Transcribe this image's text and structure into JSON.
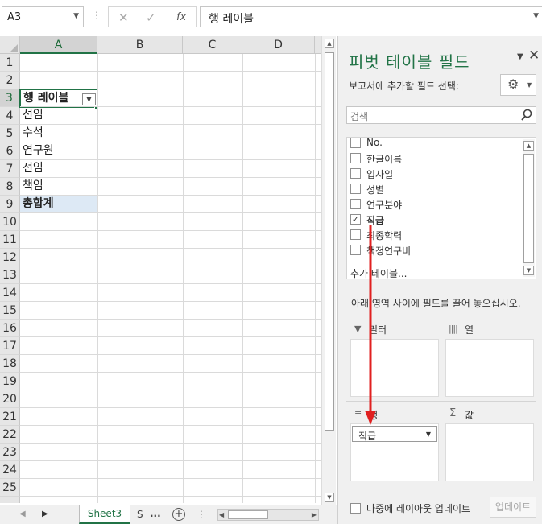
{
  "formula_bar": {
    "name_box": "A3",
    "cancel_icon": "✕",
    "enter_icon": "✓",
    "function_icon": "fx",
    "content": "행 레이블"
  },
  "grid": {
    "columns": [
      "A",
      "B",
      "C",
      "D"
    ],
    "rows": [
      "1",
      "2",
      "3",
      "4",
      "5",
      "6",
      "7",
      "8",
      "9",
      "10",
      "11",
      "12",
      "13",
      "14",
      "15",
      "16",
      "17",
      "18",
      "19",
      "20",
      "21",
      "22",
      "23",
      "24",
      "25"
    ],
    "cells": {
      "A3": "행 레이블",
      "A4": "선임",
      "A5": "수석",
      "A6": "연구원",
      "A7": "전임",
      "A8": "책임",
      "A9": "총합계"
    },
    "active_cell": "A3"
  },
  "sheet_tabs": {
    "active_tab": "Sheet3",
    "truncated_tab": "S",
    "more": "...",
    "add": "+"
  },
  "pivot_pane": {
    "title": "피벗 테이블 필드",
    "subtitle": "보고서에 추가할 필드 선택:",
    "search_placeholder": "검색",
    "fields": [
      {
        "label": "No.",
        "checked": false
      },
      {
        "label": "한글이름",
        "checked": false
      },
      {
        "label": "입사일",
        "checked": false
      },
      {
        "label": "성별",
        "checked": false
      },
      {
        "label": "연구분야",
        "checked": false
      },
      {
        "label": "직급",
        "checked": true
      },
      {
        "label": "최종학력",
        "checked": false
      },
      {
        "label": "책정연구비",
        "checked": false
      }
    ],
    "more_tables": "추가 테이블...",
    "areas_instructions": "아래 영역 사이에 필드를 끌어 놓으십시오.",
    "areas": {
      "filters": "필터",
      "columns": "열",
      "rows": "행",
      "values": "값"
    },
    "rows_chip": "직급",
    "defer_label": "나중에 레이아웃 업데이트",
    "update_button": "업데이트"
  },
  "colors": {
    "accent": "#217346",
    "arrow": "#e02020",
    "total_row": "#dde9f5"
  }
}
